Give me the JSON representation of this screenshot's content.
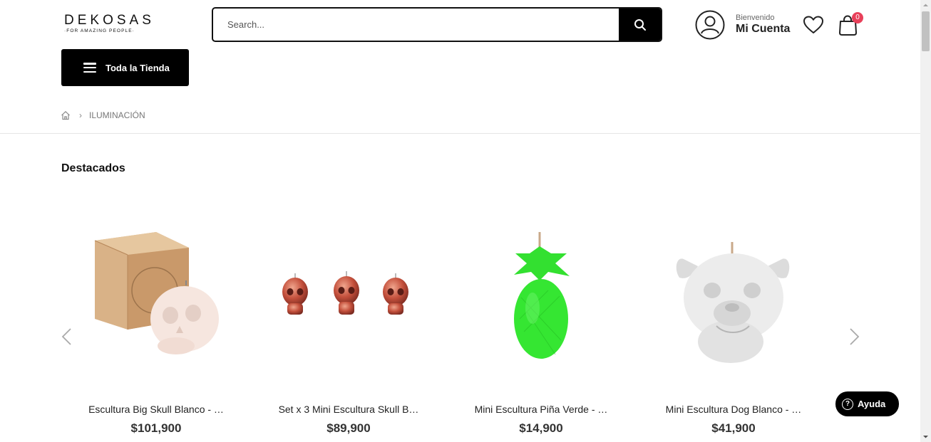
{
  "header": {
    "logo_main": "DEKOSAS",
    "logo_sub": "·FOR AMAZING PEOPLE·",
    "search_placeholder": "Search...",
    "account_greeting": "Bienvenido",
    "account_name": "Mi Cuenta",
    "cart_count": "0"
  },
  "nav": {
    "store_button": "Toda la Tienda"
  },
  "breadcrumb": {
    "home_icon": "home-icon",
    "current": "ILUMINACIÓN"
  },
  "section": {
    "title": "Destacados"
  },
  "products": [
    {
      "name": "Escultura Big Skull Blanco - …",
      "price": "$101,900"
    },
    {
      "name": "Set x 3 Mini Escultura Skull B…",
      "price": "$89,900"
    },
    {
      "name": "Mini Escultura Piña Verde - …",
      "price": "$14,900"
    },
    {
      "name": "Mini Escultura Dog Blanco - …",
      "price": "$41,900"
    }
  ],
  "help": {
    "label": "Ayuda"
  },
  "colors": {
    "primary": "#000000",
    "badge": "#e8405a",
    "text": "#222222",
    "muted": "#777777"
  }
}
